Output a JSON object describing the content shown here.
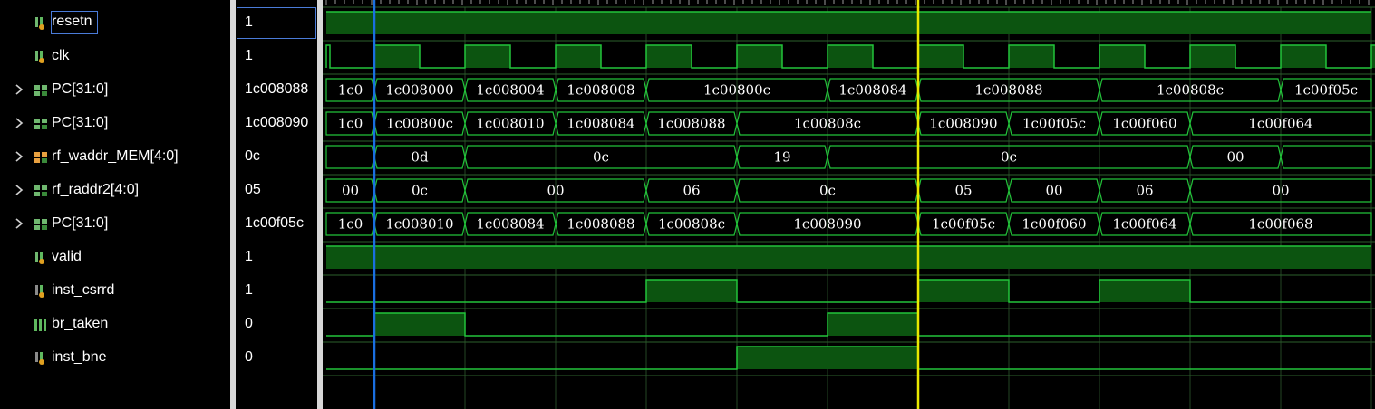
{
  "colors": {
    "wave": "#22c43a",
    "fill": "#0c5410",
    "text": "#ffffff",
    "cursor_blue": "#1a6fe0",
    "cursor_yellow": "#e8e800"
  },
  "signals": [
    {
      "name": "resetn",
      "value": "1",
      "type": "bit",
      "icon": "bit-signal-icon",
      "expandable": false,
      "selected": true
    },
    {
      "name": "clk",
      "value": "1",
      "type": "bit",
      "icon": "bit-signal-icon",
      "expandable": false
    },
    {
      "name": "PC[31:0]",
      "value": "1c008088",
      "type": "bus",
      "icon": "bus-signal-icon",
      "expandable": true
    },
    {
      "name": "PC[31:0]",
      "value": "1c008090",
      "type": "bus",
      "icon": "bus-signal-icon",
      "expandable": true
    },
    {
      "name": "rf_waddr_MEM[4:0]",
      "value": "0c",
      "type": "bus",
      "icon": "bus-signal-orange-icon",
      "expandable": true
    },
    {
      "name": "rf_raddr2[4:0]",
      "value": "05",
      "type": "bus",
      "icon": "bus-signal-icon",
      "expandable": true
    },
    {
      "name": "PC[31:0]",
      "value": "1c00f05c",
      "type": "bus",
      "icon": "bus-signal-icon",
      "expandable": true
    },
    {
      "name": "valid",
      "value": "1",
      "type": "bit",
      "icon": "bit-signal-icon",
      "expandable": false
    },
    {
      "name": "inst_csrrd",
      "value": "1",
      "type": "bit",
      "icon": "bit-signal-gray-icon",
      "expandable": false
    },
    {
      "name": "br_taken",
      "value": "0",
      "type": "bit",
      "icon": "bit-signal-multi-icon",
      "expandable": false
    },
    {
      "name": "inst_bne",
      "value": "0",
      "type": "bit",
      "icon": "bit-signal-gray-icon",
      "expandable": false
    }
  ],
  "waveforms": [
    {
      "kind": "bit",
      "levels": [
        1,
        1,
        1,
        1,
        1,
        1,
        1,
        1,
        1,
        1,
        1,
        1,
        1,
        1,
        1,
        1,
        1,
        1,
        1,
        1,
        1,
        1,
        1,
        1
      ]
    },
    {
      "kind": "clock"
    },
    {
      "kind": "bus",
      "labels": [
        "1c0",
        "1c008000",
        "1c008004",
        "1c008008",
        "1c00800c",
        "1c00800c",
        "1c008084",
        "1c008088",
        "1c008088",
        "1c00808c",
        "1c00808c",
        "1c00f05c"
      ]
    },
    {
      "kind": "bus",
      "labels": [
        "1c0",
        "1c00800c",
        "1c008010",
        "1c008084",
        "1c008088",
        "1c00808c",
        "1c00808c",
        "1c008090",
        "1c00f05c",
        "1c00f060",
        "1c00f064",
        "1c00f064"
      ]
    },
    {
      "kind": "bus",
      "labels": [
        "",
        "0d",
        "0c",
        "0c",
        "0c",
        "19",
        "0c",
        "0c",
        "0c",
        "0c",
        "00",
        ""
      ]
    },
    {
      "kind": "bus",
      "labels": [
        "00",
        "0c",
        "00",
        "00",
        "06",
        "0c",
        "0c",
        "05",
        "00",
        "06",
        "00",
        "00"
      ]
    },
    {
      "kind": "bus",
      "labels": [
        "1c0",
        "1c008010",
        "1c008084",
        "1c008088",
        "1c00808c",
        "1c008090",
        "1c008090",
        "1c00f05c",
        "1c00f060",
        "1c00f064",
        "1c00f068",
        "1c00f068"
      ]
    },
    {
      "kind": "bit",
      "levels": [
        1,
        1,
        1,
        1,
        1,
        1,
        1,
        1,
        1,
        1,
        1,
        1
      ]
    },
    {
      "kind": "bit",
      "levels": [
        0,
        0,
        0,
        0,
        1,
        0,
        0,
        1,
        0,
        1,
        0,
        0
      ]
    },
    {
      "kind": "bit",
      "levels": [
        0,
        1,
        0,
        0,
        0,
        0,
        1,
        0,
        0,
        0,
        0,
        0
      ]
    },
    {
      "kind": "bit",
      "levels": [
        0,
        0,
        0,
        0,
        0,
        1,
        1,
        0,
        0,
        0,
        0,
        0
      ]
    }
  ]
}
